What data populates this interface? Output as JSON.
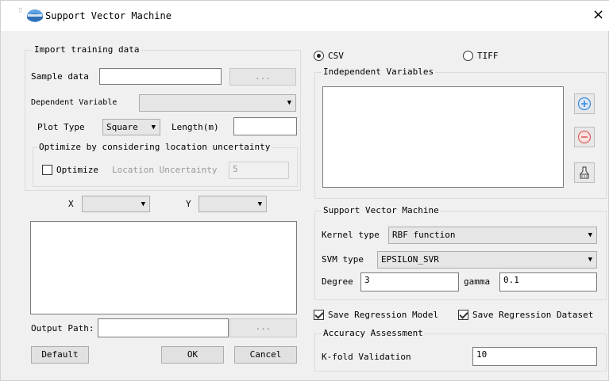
{
  "window": {
    "title": "Support Vector Machine",
    "close_glyph": "×"
  },
  "import": {
    "group_title": "Import training data",
    "sample_label": "Sample data",
    "sample_value": "",
    "browse": "...",
    "dependent_label": "Dependent Variable",
    "dependent_value": "",
    "plot_type_label": "Plot Type",
    "plot_type_value": "Square",
    "length_label": "Length(m)",
    "length_value": "",
    "optimize_group": "Optimize by considering location uncertainty",
    "optimize_checkbox": "Optimize",
    "optimize_checked": false,
    "location_uncertainty_label": "Location Uncertainty",
    "location_uncertainty_value": "5"
  },
  "xy": {
    "x_label": "X",
    "x_value": "",
    "y_label": "Y",
    "y_value": ""
  },
  "output": {
    "label": "Output Path:",
    "value": "",
    "browse": "..."
  },
  "buttons": {
    "default": "Default",
    "ok": "OK",
    "cancel": "Cancel"
  },
  "format": {
    "csv_label": "CSV",
    "csv_selected": true,
    "tiff_label": "TIFF",
    "tiff_selected": false
  },
  "independent": {
    "group_title": "Independent Variables",
    "items": []
  },
  "side_icons": [
    "add-icon",
    "remove-icon",
    "clear-icon"
  ],
  "svm": {
    "group_title": "Support Vector Machine",
    "kernel_label": "Kernel type",
    "kernel_value": "RBF function",
    "svm_type_label": "SVM type",
    "svm_type_value": "EPSILON_SVR",
    "degree_label": "Degree",
    "degree_value": "3",
    "gamma_label": "gamma",
    "gamma_value": "0.1"
  },
  "save": {
    "model_label": "Save Regression Model",
    "model_checked": true,
    "dataset_label": "Save Regression Dataset",
    "dataset_checked": true
  },
  "accuracy": {
    "group_title": "Accuracy Assessment",
    "kfold_label": "K-fold Validation",
    "kfold_value": "10"
  },
  "colors": {
    "plus": "#3b86d8",
    "minus": "#e06060",
    "window_bg": "#f0f0f0"
  }
}
